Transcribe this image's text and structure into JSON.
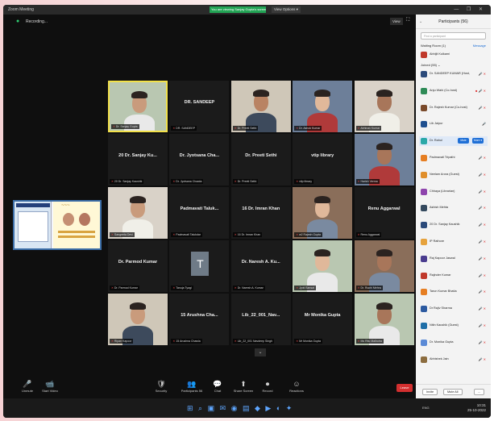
{
  "window": {
    "title": "Zoom Meeting",
    "share_status": "You are viewing Sanjay Gupta's screen",
    "view_options": "View Options ▾",
    "controls": "— ❐ ✕"
  },
  "topbar": {
    "info": "Recording...",
    "view": "View",
    "fullscreen": "⛶"
  },
  "tiles": [
    {
      "name": "",
      "caption": "Dr. Sanjay Gupta",
      "kind": "video",
      "active": true
    },
    {
      "name": "DR. SANDEEP",
      "caption": "DR. SANDEEP",
      "kind": "name"
    },
    {
      "name": "",
      "caption": "Dr. Preeti Sethi",
      "kind": "video"
    },
    {
      "name": "",
      "caption": "Dr. Ashok Kumar",
      "kind": "video"
    },
    {
      "name": "",
      "caption": "Abhinav Kumar",
      "kind": "video"
    },
    {
      "name": "20 Dr. Sanjay Ku...",
      "caption": "20 Dr. Sanjay Kaushik",
      "kind": "name"
    },
    {
      "name": "Dr. Jyotsana Cha...",
      "caption": "Dr. Jyotsana Chawla",
      "kind": "name"
    },
    {
      "name": "Dr. Preeti Sethi",
      "caption": "Dr. Preeti Sethi",
      "kind": "name"
    },
    {
      "name": "vtip library",
      "caption": "vtip library",
      "kind": "name"
    },
    {
      "name": "",
      "caption": "Harish Verma",
      "kind": "video"
    },
    {
      "name": "",
      "caption": "Sangeeta Devi",
      "kind": "video"
    },
    {
      "name": "Padmavati Taluk...",
      "caption": "Padmavati Talukdar",
      "kind": "name"
    },
    {
      "name": "16 Dr. Imran Khan",
      "caption": "16 Dr. Imran Khan",
      "kind": "name"
    },
    {
      "name": "",
      "caption": "w2 Rajesh Gupta",
      "kind": "video"
    },
    {
      "name": "Renu Aggarwal",
      "caption": "Renu Aggarwal",
      "kind": "name"
    },
    {
      "name": "Dr. Parmod Kumar",
      "caption": "Dr. Parmod Kumar",
      "kind": "name"
    },
    {
      "name": "",
      "caption": "Tanuja Tyagi",
      "kind": "letter",
      "letter": "T"
    },
    {
      "name": "Dr. Naresh A. Ku...",
      "caption": "Dr. Naresh A. Kumar",
      "kind": "name"
    },
    {
      "name": "",
      "caption": "Jyoti Bansal",
      "kind": "video"
    },
    {
      "name": "",
      "caption": "Dr. Ruchi Mehra",
      "kind": "video"
    },
    {
      "name": "",
      "caption": "Ripan Kapoor",
      "kind": "video"
    },
    {
      "name": "15 Arushna Cha...",
      "caption": "15 Arushna Chawla",
      "kind": "name"
    },
    {
      "name": "Lib_22_001_Nav...",
      "caption": "Lib_22_001 Navdeep Singh",
      "kind": "name"
    },
    {
      "name": "Mr Monika Gupta",
      "caption": "Mr Monika Gupta",
      "kind": "name"
    },
    {
      "name": "",
      "caption": "Ms Ritu Malhotra",
      "kind": "video"
    }
  ],
  "bottombar": {
    "items": [
      {
        "icon": "🎤",
        "label": "Unmute"
      },
      {
        "icon": "📹",
        "label": "Start Video"
      },
      {
        "icon": "🛡",
        "label": "Security"
      },
      {
        "icon": "👥",
        "label": "Participants 56"
      },
      {
        "icon": "💬",
        "label": "Chat"
      },
      {
        "icon": "⬆",
        "label": "Share Screen"
      },
      {
        "icon": "⏺",
        "label": "Record"
      },
      {
        "icon": "☺",
        "label": "Reactions"
      }
    ],
    "leave": "Leave"
  },
  "taskbar": {
    "icons": "⊞ ⌕ ▣ ✉ ◉ ▤ ◆ ▶ ◐ ✦",
    "time": "10:31",
    "date": "25-10-2022",
    "sys": "ENG"
  },
  "participants": {
    "title": "Participants (56)",
    "collapse": "⌄",
    "search_placeholder": "Find a participant",
    "waiting_label": "Waiting Room (1)",
    "admit_all": "Message",
    "in_meeting_label": "Joined (55) ⌄",
    "waiting": [
      {
        "name": "Abhijit Kulkarni",
        "color": "#c0392b",
        "status": ""
      }
    ],
    "list": [
      {
        "name": "Dr. SANDEEP KUMAR (Host, me)",
        "color": "#2b4a7a",
        "status": "🎤 ✕"
      },
      {
        "name": "Anju Wahi (Co-host)",
        "color": "#2e8b57",
        "status": "■ 🎤 ✕"
      },
      {
        "name": "Dr. Rajesh Kumar (Co-host)",
        "color": "#7a4a2b",
        "status": "🎤 ✕"
      },
      {
        "name": "Lib Jaipur",
        "color": "#1f4f8f",
        "status": "🎤"
      },
      {
        "name": "Dr. Rahul",
        "color": "#2aa8a8",
        "status": "",
        "selected": true,
        "btn1": "Mute",
        "btn2": "More ▾"
      },
      {
        "name": "Padmavati Tripathi",
        "color": "#e67e22",
        "status": "🎤 ✕"
      },
      {
        "name": "Neelam Arora (Guest)",
        "color": "#e08e2b",
        "status": "🎤 ✕"
      },
      {
        "name": "Chhaya (Librarian)",
        "color": "#8e44ad",
        "status": "🎤 ✕"
      },
      {
        "name": "Ashish Mehta",
        "color": "#34495e",
        "status": "🎤 ✕"
      },
      {
        "name": "20 Dr. Sanjay Kaushik",
        "color": "#2b4a7a",
        "status": "🎤 ✕"
      },
      {
        "name": "IP Rathore",
        "color": "#e6a23c",
        "status": "🎤 ✕"
      },
      {
        "name": "Raj Kapoor Jaswal",
        "color": "#4a3c8f",
        "status": "🎤 ✕"
      },
      {
        "name": "Rajinder Kumar",
        "color": "#c0392b",
        "status": "🎤 ✕"
      },
      {
        "name": "Tarun Kumar Bhatia",
        "color": "#e67e22",
        "status": "🎤 ✕"
      },
      {
        "name": "Dr Rajiv Sharma",
        "color": "#2c5aa0",
        "status": "🎤 ✕"
      },
      {
        "name": "Nitin Kaushik (Guest)",
        "color": "#1f6fa8",
        "status": "🎤 ✕"
      },
      {
        "name": "Dr. Monika Gupta",
        "color": "#5b8ad6",
        "status": "🎤 ✕"
      },
      {
        "name": "Abhishek Jain",
        "color": "#8c6d3f",
        "status": "🎤 ✕"
      }
    ],
    "footer": {
      "invite": "Invite",
      "mute_all": "Mute All",
      "more": "..."
    }
  }
}
